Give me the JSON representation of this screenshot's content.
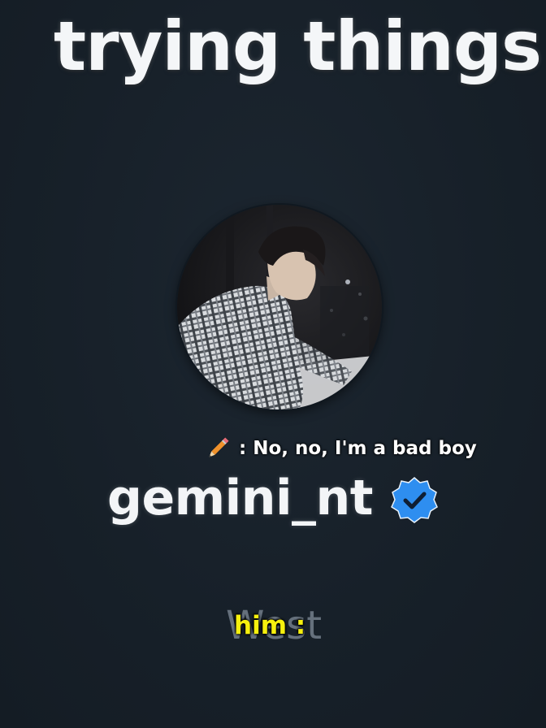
{
  "overlay": {
    "headline": "trying things",
    "caption": {
      "icon": "pencil-icon",
      "text": ": No, no, I'm a bad boy"
    },
    "profile": {
      "avatar": "profile-photo",
      "username": "gemini_nt",
      "verified_icon": "verified-badge-icon",
      "verified_color": "#2e8ef0"
    },
    "bottom_word": "West",
    "subtitle": "him :"
  },
  "colors": {
    "background": "#17202a",
    "subtitle_text": "#f6f00e"
  }
}
